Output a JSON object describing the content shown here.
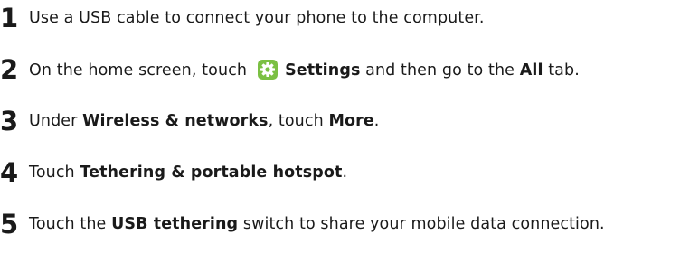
{
  "steps": [
    {
      "number": "1",
      "text": "Use a USB cable to connect your phone to the computer."
    },
    {
      "number": "2",
      "pre": "On the home screen, touch",
      "icon": "settings-gear-icon",
      "b1": "Settings",
      "mid": "and then go to the",
      "b2": "All",
      "post": "tab."
    },
    {
      "number": "3",
      "pre": "Under",
      "b1": "Wireless & networks",
      "mid": ", touch",
      "b2": "More",
      "post": "."
    },
    {
      "number": "4",
      "pre": "Touch",
      "b1": "Tethering & portable hotspot",
      "post": "."
    },
    {
      "number": "5",
      "pre": "Touch the",
      "b1": "USB tethering",
      "post": "switch to share your mobile data connection."
    }
  ],
  "colors": {
    "text": "#1a1a1a",
    "icon_bg": "#7bc043",
    "icon_fg": "#ffffff"
  }
}
